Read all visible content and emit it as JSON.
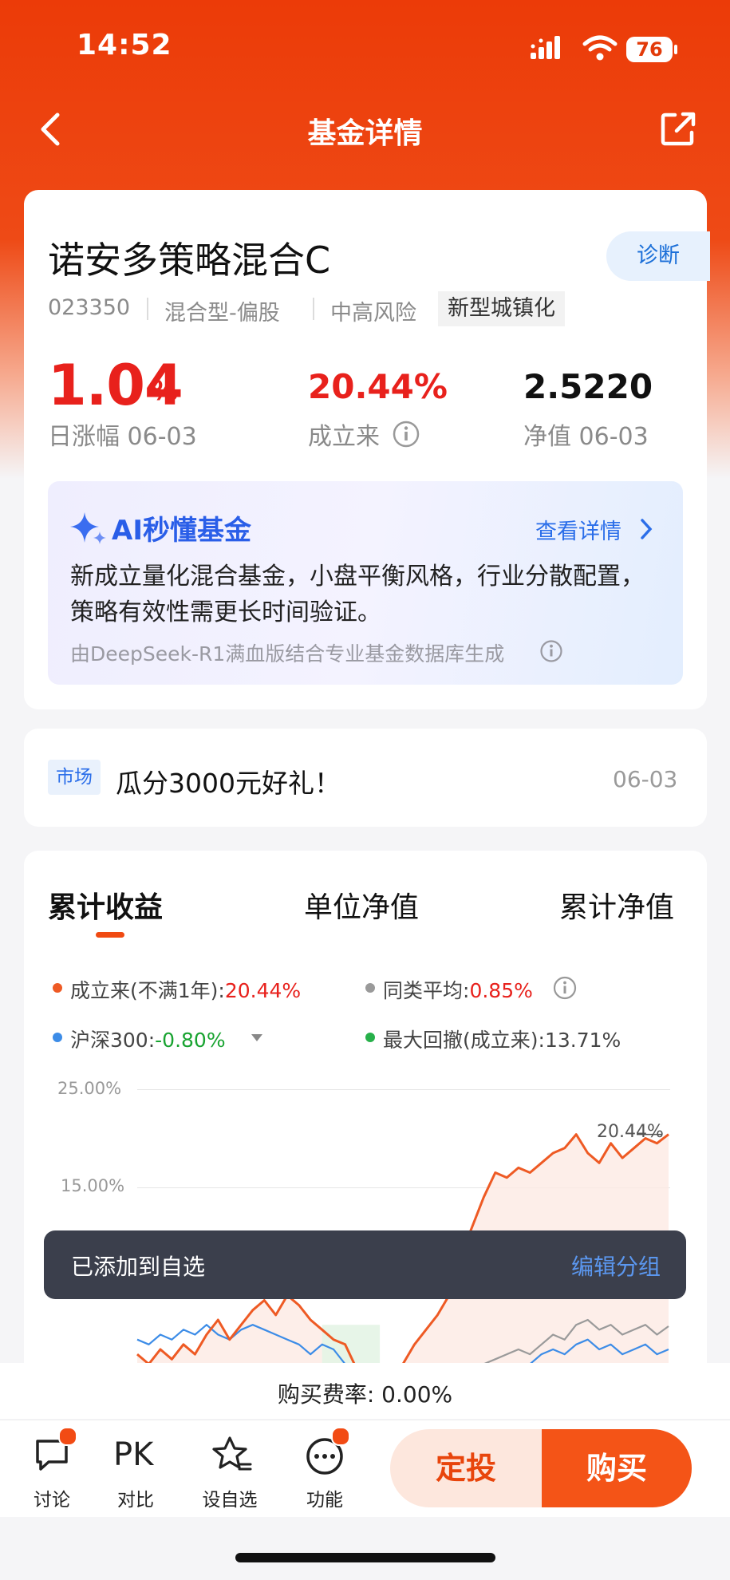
{
  "status": {
    "time": "14:52",
    "battery": "76"
  },
  "nav": {
    "title": "基金详情"
  },
  "fund": {
    "name": "诺安多策略混合C",
    "diagnose": "诊断",
    "code": "023350",
    "type": "混合型-偏股",
    "risk": "中高风险",
    "theme_tag": "新型城镇化",
    "day_change": "1.04",
    "day_change_unit": "%",
    "day_change_label": "日涨幅 06-03",
    "since_inception": "20.44%",
    "since_inception_label": "成立来",
    "nav_value": "2.5220",
    "nav_label": "净值 06-03"
  },
  "ai": {
    "title": "AI秒懂基金",
    "link": "查看详情",
    "text": "新成立量化混合基金，小盘平衡风格，行业分散配置，策略有效性需更长时间验证。",
    "footer": "由DeepSeek-R1满血版结合专业基金数据库生成"
  },
  "market": {
    "tag": "市场",
    "text": "瓜分3000元好礼！",
    "date": "06-03"
  },
  "chart_tabs": [
    "累计收益",
    "单位净值",
    "累计净值"
  ],
  "legend": {
    "fund_label": "成立来(不满1年):",
    "fund_value": "20.44%",
    "peer_label": "同类平均:",
    "peer_value": "0.85%",
    "index_label": "沪深300:",
    "index_value": "-0.80%",
    "drawdown_label": "最大回撤(成立来):",
    "drawdown_value": "13.71%"
  },
  "chart_data": {
    "type": "line",
    "y_ticks": [
      "25.00%",
      "15.00%"
    ],
    "peak_label": "20.44%",
    "ylim": [
      -8,
      25
    ],
    "series": [
      {
        "name": "成立来",
        "color": "#ee5a24",
        "values": [
          -2.0,
          -3.0,
          -1.5,
          -2.5,
          -1.0,
          -2.0,
          0.0,
          1.5,
          -0.5,
          1.0,
          2.5,
          3.5,
          2.0,
          4.0,
          3.0,
          1.5,
          0.5,
          -0.5,
          -1.0,
          -3.5,
          -7.5,
          -8.0,
          -6.5,
          -3.0,
          -1.0,
          0.5,
          2.0,
          4.0,
          8.0,
          11.0,
          14.0,
          16.5,
          16.0,
          17.0,
          16.5,
          17.5,
          18.5,
          19.0,
          20.4,
          18.5,
          17.5,
          19.5,
          18.0,
          19.0,
          20.0,
          19.5,
          20.4
        ]
      },
      {
        "name": "沪深300",
        "color": "#3c8ce7",
        "values": [
          -0.5,
          -1.0,
          0.0,
          -0.5,
          0.5,
          0.0,
          1.0,
          0.0,
          -0.5,
          0.5,
          1.0,
          0.5,
          0.0,
          -0.5,
          -1.0,
          -2.0,
          -1.0,
          -1.5,
          -3.0,
          -5.0,
          -6.0,
          -7.0,
          -7.5,
          -7.0,
          -6.0,
          -5.5,
          -6.0,
          -5.0,
          -4.5,
          -4.0,
          -4.5,
          -3.5,
          -3.0,
          -4.0,
          -3.0,
          -2.0,
          -1.5,
          -2.0,
          -1.0,
          -0.5,
          -1.5,
          -1.0,
          -2.0,
          -1.5,
          -1.0,
          -2.0,
          -1.5
        ]
      },
      {
        "name": "同类平均",
        "color": "#9a9a9a",
        "values": [
          null,
          null,
          null,
          null,
          null,
          null,
          null,
          null,
          null,
          null,
          null,
          null,
          null,
          null,
          null,
          null,
          null,
          null,
          null,
          null,
          null,
          null,
          null,
          null,
          null,
          null,
          -6.0,
          -5.0,
          -4.5,
          -4.0,
          -3.0,
          -2.5,
          -2.0,
          -1.5,
          -2.0,
          -1.0,
          0.0,
          -0.5,
          1.0,
          1.5,
          0.5,
          1.0,
          0.0,
          0.5,
          1.0,
          0.0,
          0.85
        ]
      }
    ]
  },
  "toast": {
    "message": "已添加到自选",
    "action": "编辑分组"
  },
  "fee": {
    "text": "购买费率: 0.00%"
  },
  "bottom": {
    "discuss": "讨论",
    "compare_icon": "PK",
    "compare": "对比",
    "watch": "设自选",
    "more": "功能",
    "invest": "定投",
    "buy": "购买"
  }
}
